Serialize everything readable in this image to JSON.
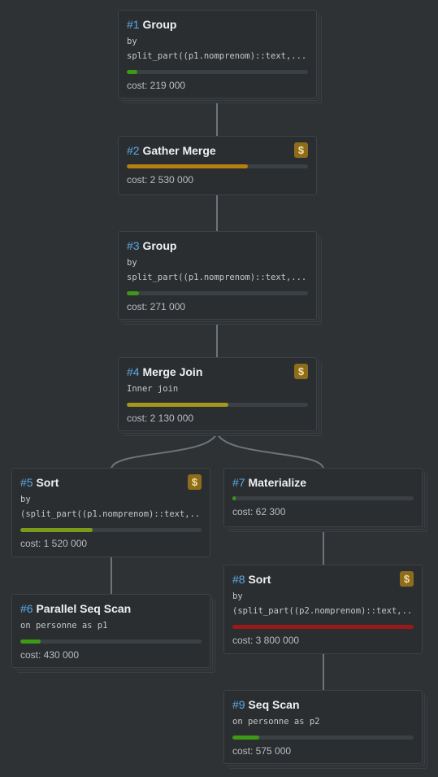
{
  "colors": {
    "background": "#2e3235",
    "node": "#2b2e31",
    "id": "#5aaae6",
    "badge": "#8d6d1b"
  },
  "nodes": [
    {
      "id": "#1",
      "name": "Group",
      "detail1": "by",
      "detail2": "split_part((p1.nomprenom)::text,...",
      "cost": "cost: 219 000",
      "ratio": 0.058,
      "bar_color": "#3d9a17",
      "badge": ""
    },
    {
      "id": "#2",
      "name": "Gather Merge",
      "detail1": "",
      "detail2": "",
      "cost": "cost: 2 530 000",
      "ratio": 0.67,
      "bar_color": "#b77e10",
      "badge": "$"
    },
    {
      "id": "#3",
      "name": "Group",
      "detail1": "by",
      "detail2": "split_part((p1.nomprenom)::text,...",
      "cost": "cost: 271 000",
      "ratio": 0.067,
      "bar_color": "#3d9a17",
      "badge": ""
    },
    {
      "id": "#4",
      "name": "Merge Join",
      "detail1": "Inner join",
      "detail2": "",
      "cost": "cost: 2 130 000",
      "ratio": 0.56,
      "bar_color": "#a49720",
      "badge": "$"
    },
    {
      "id": "#5",
      "name": "Sort",
      "detail1": "by",
      "detail2": "(split_part((p1.nomprenom)::text,...",
      "cost": "cost: 1 520 000",
      "ratio": 0.4,
      "bar_color": "#7d9b1b",
      "badge": "$"
    },
    {
      "id": "#6",
      "name": "Parallel Seq Scan",
      "detail1": "on personne as p1",
      "detail2": "",
      "cost": "cost: 430 000",
      "ratio": 0.113,
      "bar_color": "#3d9a17",
      "badge": ""
    },
    {
      "id": "#7",
      "name": "Materialize",
      "detail1": "",
      "detail2": "",
      "cost": "cost: 62 300",
      "ratio": 0.018,
      "bar_color": "#3d9a17",
      "badge": ""
    },
    {
      "id": "#8",
      "name": "Sort",
      "detail1": "by",
      "detail2": "(split_part((p2.nomprenom)::text,...",
      "cost": "cost: 3 800 000",
      "ratio": 1.0,
      "bar_color": "#9b1818",
      "badge": "$"
    },
    {
      "id": "#9",
      "name": "Seq Scan",
      "detail1": "on personne as p2",
      "detail2": "",
      "cost": "cost: 575 000",
      "ratio": 0.146,
      "bar_color": "#3d9a17",
      "badge": ""
    }
  ]
}
